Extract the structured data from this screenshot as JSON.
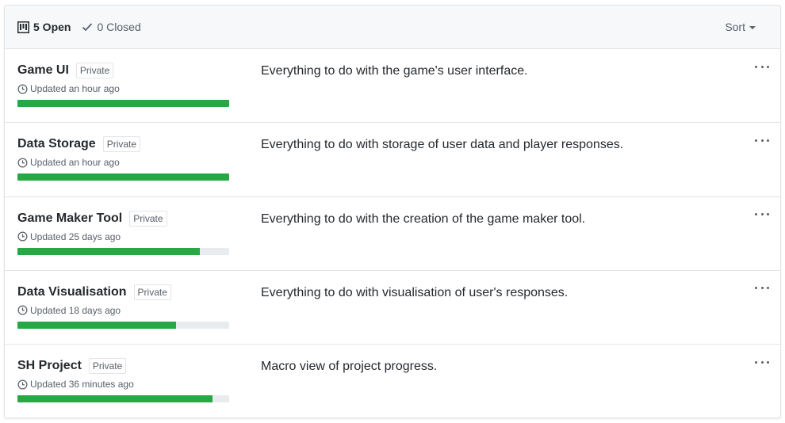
{
  "header": {
    "open_label": "5 Open",
    "closed_label": "0 Closed",
    "sort_label": "Sort"
  },
  "colors": {
    "progress_fill": "#28a745",
    "progress_track": "#e9ecef"
  },
  "projects": [
    {
      "name": "Game UI",
      "visibility": "Private",
      "updated": "Updated an hour ago",
      "description": "Everything to do with the game's user interface.",
      "progress": 1.0
    },
    {
      "name": "Data Storage",
      "visibility": "Private",
      "updated": "Updated an hour ago",
      "description": "Everything to do with storage of user data and player responses.",
      "progress": 1.0
    },
    {
      "name": "Game Maker Tool",
      "visibility": "Private",
      "updated": "Updated 25 days ago",
      "description": "Everything to do with the creation of the game maker tool.",
      "progress": 0.86
    },
    {
      "name": "Data Visualisation",
      "visibility": "Private",
      "updated": "Updated 18 days ago",
      "description": "Everything to do with visualisation of user's responses.",
      "progress": 0.75
    },
    {
      "name": "SH Project",
      "visibility": "Private",
      "updated": "Updated 36 minutes ago",
      "description": "Macro view of project progress.",
      "progress": 0.92
    }
  ]
}
